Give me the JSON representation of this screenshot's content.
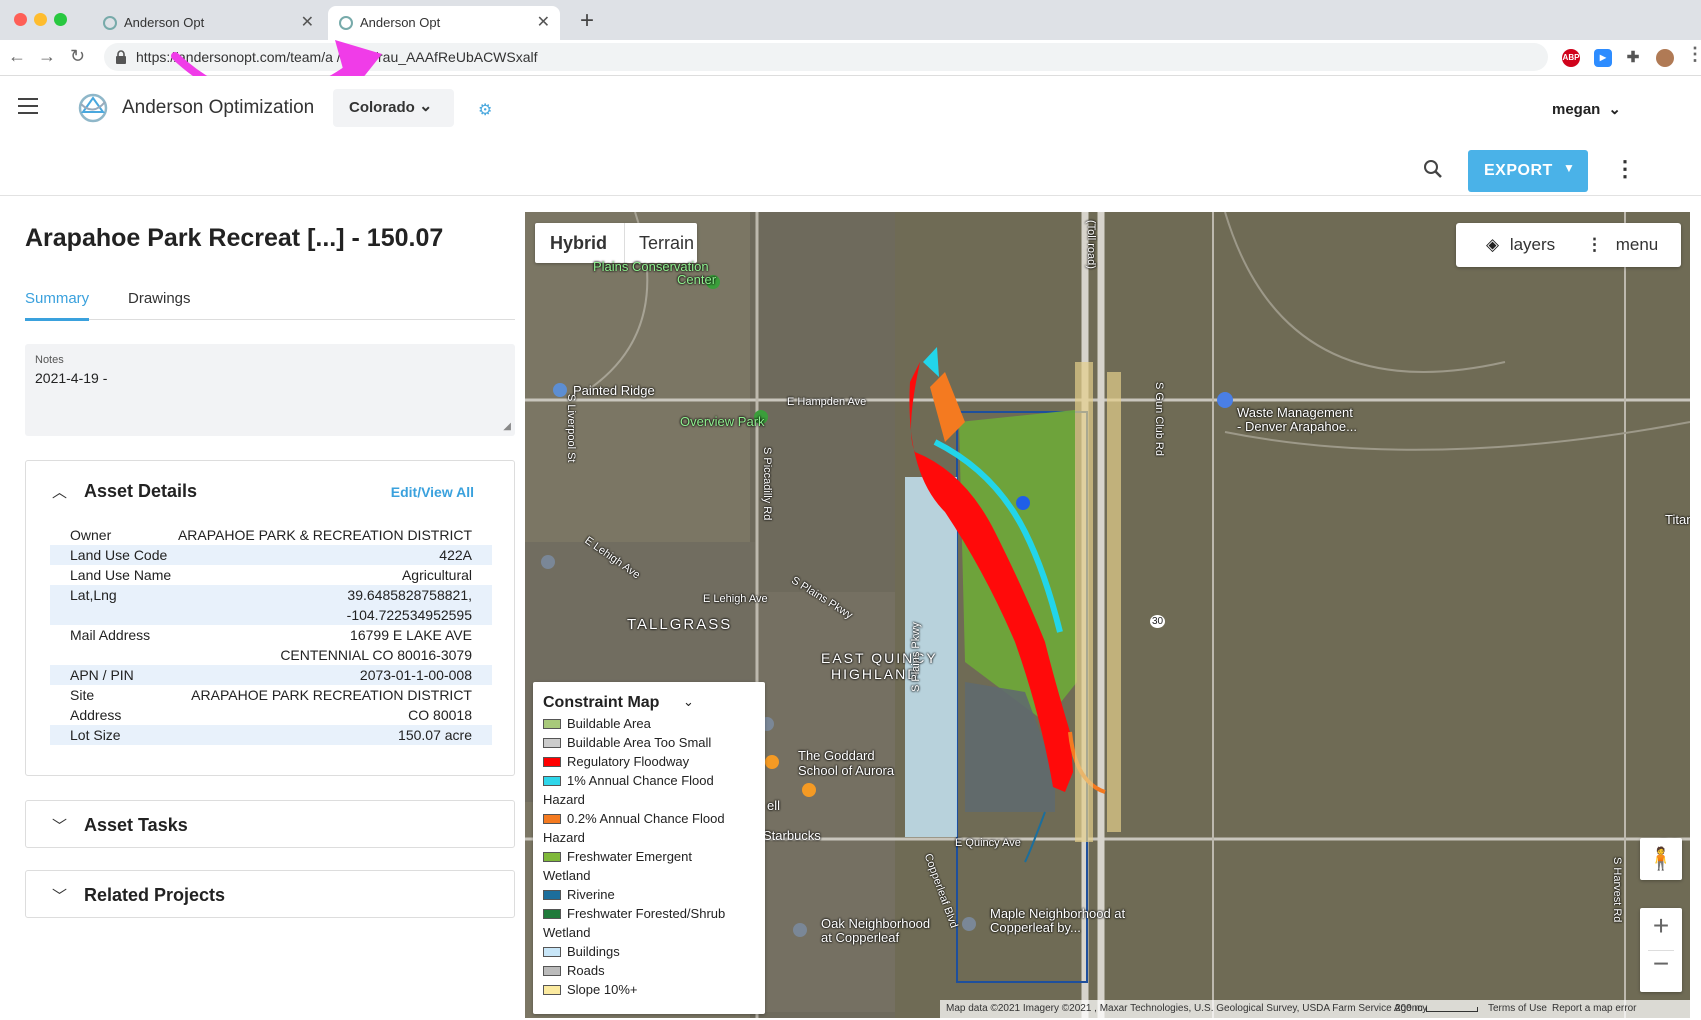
{
  "browser": {
    "tabs": [
      {
        "title": "Anderson Opt",
        "active": false
      },
      {
        "title": "Anderson Opt",
        "active": true
      }
    ],
    "url": "https://andersonopt.com/team/a.../asset/rau_AAAfReUbACWSxalf",
    "url_display": "https://andersonopt.com/team/a        /asset/rau_AAAfReUbACWSxalf",
    "extensions": [
      "ABP",
      "zoom",
      "puzzle",
      "avatar"
    ]
  },
  "app": {
    "name": "Anderson Optimization",
    "state_selector": "Colorado",
    "user": "megan",
    "export_label": "EXPORT"
  },
  "asset": {
    "title": "Arapahoe Park Recreat [...] - 150.07",
    "tabs": [
      "Summary",
      "Drawings"
    ],
    "notes_label": "Notes",
    "notes_value": "2021-4-19 -",
    "details_header": "Asset Details",
    "edit_link": "Edit/View All",
    "details": [
      {
        "key": "Owner",
        "value": "ARAPAHOE PARK & RECREATION DISTRICT"
      },
      {
        "key": "Land Use Code",
        "value": "422A"
      },
      {
        "key": "Land Use Name",
        "value": "Agricultural"
      },
      {
        "key": "Lat,Lng",
        "value": "39.6485828758821,",
        "value2": "-104.722534952595"
      },
      {
        "key": "Mail Address",
        "value": "16799 E LAKE AVE",
        "value2": "CENTENNIAL CO  80016-3079"
      },
      {
        "key": "APN / PIN",
        "value": "2073-01-1-00-008"
      },
      {
        "key": "Site",
        "key2": "Address",
        "value": "ARAPAHOE PARK RECREATION DISTRICT",
        "value2": "CO 80018"
      },
      {
        "key": "Lot Size",
        "value": "150.07 acre"
      }
    ],
    "tasks_header": "Asset Tasks",
    "projects_header": "Related Projects"
  },
  "map": {
    "map_types": [
      "Hybrid",
      "Terrain"
    ],
    "layers_label": "layers",
    "menu_label": "menu",
    "legend_title": "Constraint Map",
    "legend": [
      {
        "label": "Buildable Area",
        "color": "#a8c97a"
      },
      {
        "label": "Buildable Area Too Small",
        "color": "#cccccc"
      },
      {
        "label": "Regulatory Floodway",
        "color": "#ff0000"
      },
      {
        "label": "1% Annual Chance Flood",
        "label2": "Hazard",
        "color": "#2fd6ea"
      },
      {
        "label": "0.2% Annual Chance Flood",
        "label2": "Hazard",
        "color": "#f47a20"
      },
      {
        "label": "Freshwater Emergent",
        "label2": "Wetland",
        "color": "#7fb83a"
      },
      {
        "label": "Riverine",
        "color": "#1c6e9c"
      },
      {
        "label": "Freshwater Forested/Shrub",
        "label2": "Wetland",
        "color": "#1f7a3a"
      },
      {
        "label": "Buildings",
        "color": "#c8e6f8"
      },
      {
        "label": "Roads",
        "color": "#bbbbbb"
      },
      {
        "label": "Slope 10%+",
        "color": "#fbeaa0"
      }
    ],
    "labels": {
      "plains_conservation": "Plains Conservation",
      "plains_conservation2": "Center",
      "painted_ridge": "Painted Ridge",
      "hampden": "E Hampden Ave",
      "overview_park": "Overview Park",
      "lehigh_ave": "E Lehigh Ave",
      "lehigh_ave2": "E Lehigh Ave",
      "plains_pkwy": "S Plains Pkwy",
      "tallgrass": "TALLGRASS",
      "east_quincy": "EAST QUINCY",
      "east_quincy2": "HIGHLAND",
      "waste_mgmt": "Waste Management",
      "waste_mgmt2": "- Denver Arapahoe...",
      "goddard": "The Goddard",
      "goddard2": "School of Aurora",
      "starbucks": "Starbucks",
      "quincy": "E Quincy Ave",
      "quincy_e": "E Q",
      "gun_club": "S Gun Club Rd",
      "toll_road": "(Toll road)",
      "piccadilly": "S Piccadilly Rd",
      "liverpool": "S Liverpool St",
      "oak_neighborhood": "Oak Neighborhood",
      "oak_neighborhood2": "at Copperleaf",
      "maple_neighborhood": "Maple Neighborhood at",
      "maple_neighborhood2": "Copperleaf by...",
      "harvest": "S Harvest Rd",
      "copperleaf": "Copperleaf Blvd",
      "titan": "Titan",
      "route": "30",
      "ell": "ell"
    },
    "attribution": "Map data ©2021 Imagery ©2021 , Maxar Technologies, U.S. Geological Survey, USDA Farm Service Agency",
    "scale": "200 m",
    "terms": "Terms of Use",
    "report": "Report a map error"
  }
}
